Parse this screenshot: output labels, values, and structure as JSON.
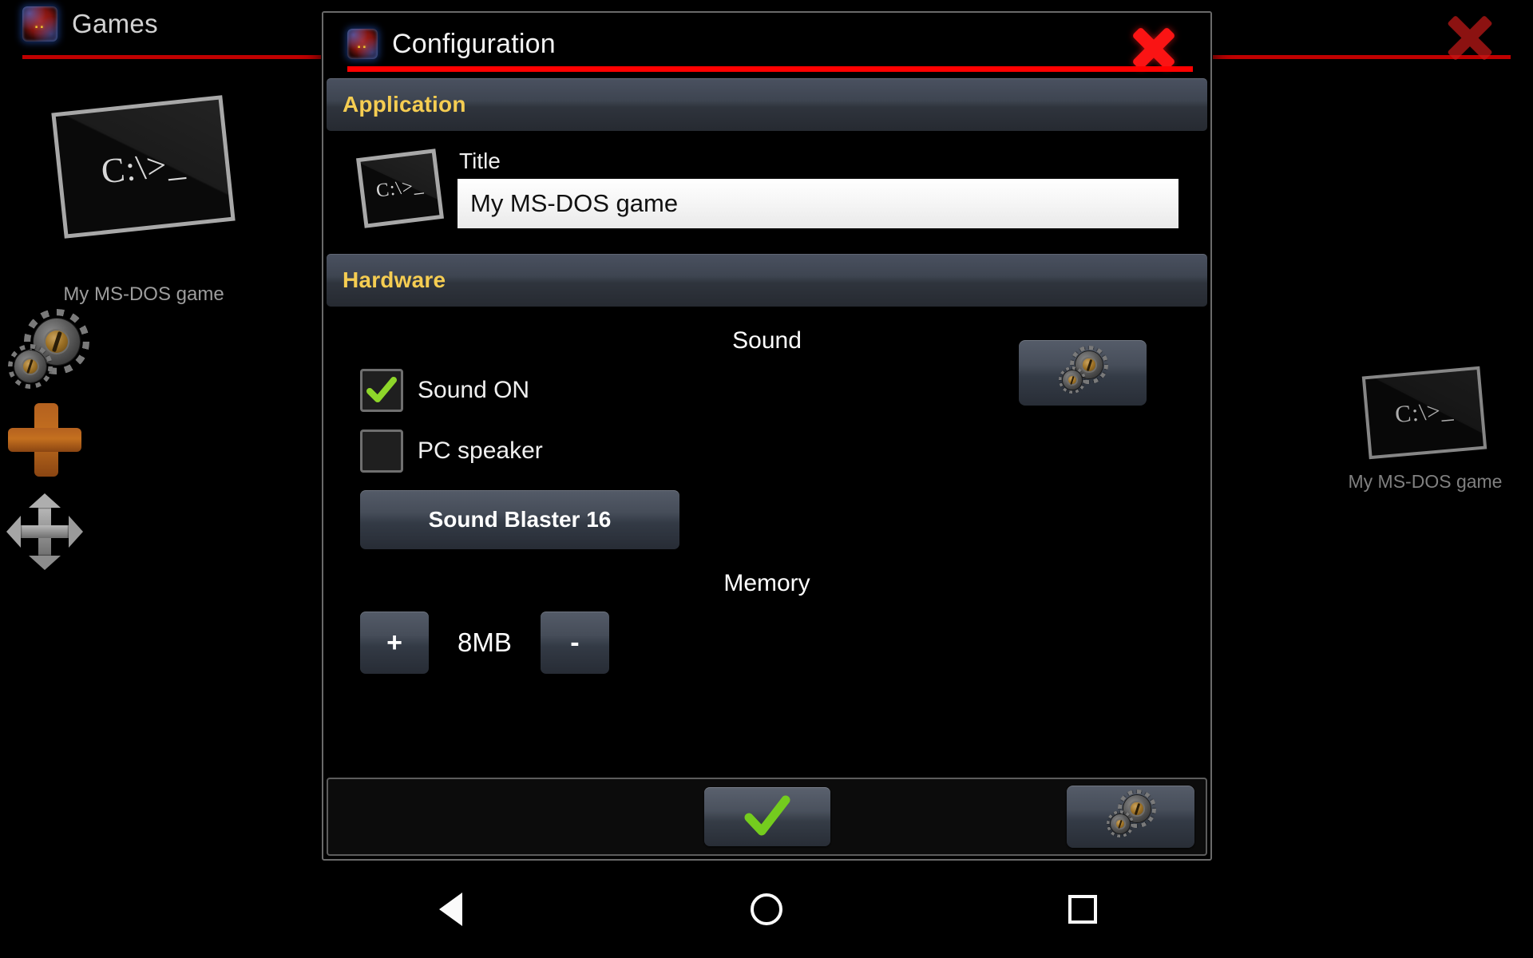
{
  "desktop": {
    "app_title": "Games",
    "app_icon": "magicdosbox-orb-icon",
    "close_icon": "close-x-icon",
    "shortcuts": [
      {
        "label": "My MS-DOS game",
        "icon": "ms-dos-prompt-icon",
        "prompt": "C:\\>_"
      },
      {
        "label": "My MS-DOS game",
        "icon": "ms-dos-prompt-icon",
        "prompt": "C:\\>_"
      }
    ],
    "rail": [
      {
        "name": "settings-gears-icon"
      },
      {
        "name": "add-plus-icon"
      },
      {
        "name": "move-arrows-icon"
      }
    ]
  },
  "dialog": {
    "title": "Configuration",
    "icon": "magicdosbox-orb-icon",
    "close_icon": "close-x-icon",
    "sections": {
      "application": {
        "header": "Application",
        "icon": "ms-dos-prompt-icon",
        "prompt": "C:\\>_",
        "title_label": "Title",
        "title_value": "My MS-DOS game",
        "title_placeholder": "Title"
      },
      "hardware": {
        "header": "Hardware",
        "sound": {
          "group_title": "Sound",
          "sound_on_label": "Sound ON",
          "sound_on_checked": true,
          "pc_speaker_label": "PC speaker",
          "pc_speaker_checked": false,
          "card_button": "Sound Blaster 16",
          "settings_icon": "gears-icon"
        },
        "memory": {
          "group_title": "Memory",
          "increase_label": "+",
          "decrease_label": "-",
          "value": "8MB"
        }
      }
    },
    "footer": {
      "ok_icon": "check-icon",
      "settings_icon": "gears-icon"
    }
  },
  "navbar": {
    "back": "back-triangle-icon",
    "home": "home-circle-icon",
    "recents": "recents-square-icon"
  },
  "colors": {
    "accent_red": "#ff0000",
    "section_text": "#f5cd52",
    "check_green": "#8ed62a",
    "plus_orange": "#c4701f"
  }
}
